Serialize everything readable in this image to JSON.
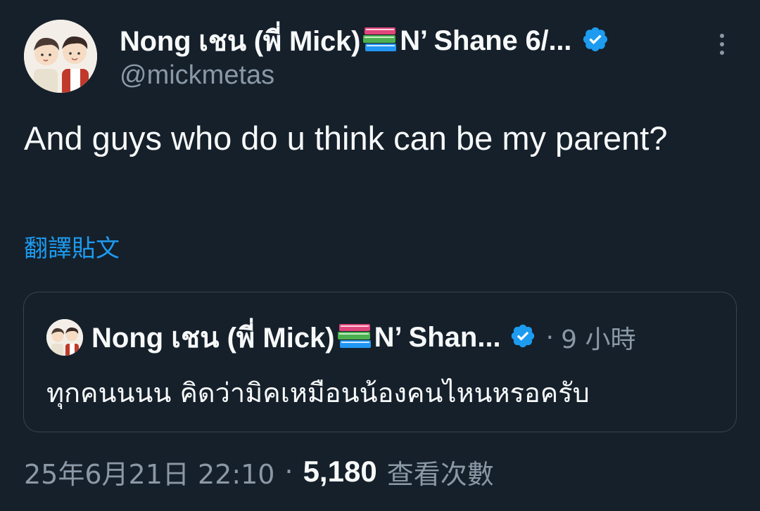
{
  "author": {
    "name_part1": "Nong เชน (พี่ Mick)",
    "books_icon": "books-emoji",
    "name_part2": "N’ Shane 6/...",
    "handle": "@mickmetas",
    "verified_color": "#1d9bf0"
  },
  "tweet": {
    "text": "And guys who do u think can be my parent?",
    "translate_label": "翻譯貼文"
  },
  "quote": {
    "name_part1": "Nong เชน (พี่ Mick)",
    "name_part2": "N’ Shan...",
    "separator": "·",
    "time": "9 小時",
    "text": "ทุกคนนนน คิดว่ามิคเหมือนน้องคนไหนหรอครับ"
  },
  "meta": {
    "timestamp": "25年6月21日 22:10",
    "separator": "·",
    "views": "5,180",
    "views_label": "查看次數"
  },
  "colors": {
    "background": "#15202b",
    "text_primary": "#f7f9f9",
    "text_secondary": "#8b98a5",
    "accent": "#1d9bf0",
    "border": "#38444d"
  }
}
